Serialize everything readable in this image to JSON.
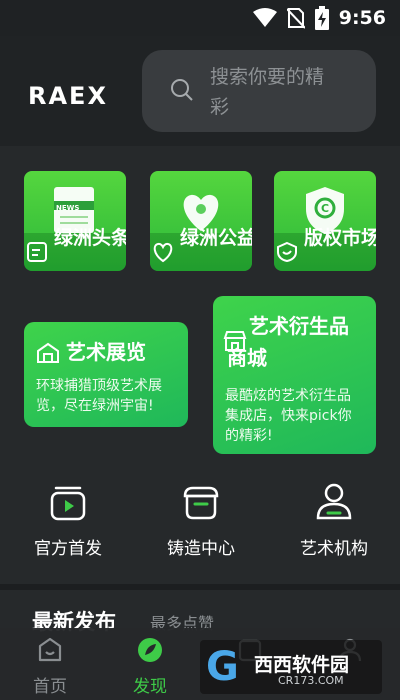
{
  "status_bar": {
    "time": "9:56",
    "icons": [
      "wifi-icon",
      "no-sim-icon",
      "battery-charging-icon"
    ]
  },
  "header": {
    "logo": "RAEX",
    "search": {
      "placeholder_line1": "搜索你要的精",
      "placeholder_line2": "彩",
      "icon": "search-icon"
    }
  },
  "tiles": [
    {
      "label": "绿洲头条",
      "badge": "NEWS",
      "art_icon": "newspaper-icon",
      "icon": "notes-icon"
    },
    {
      "label": "绿洲公益",
      "art_icon": "heart-hands-icon",
      "icon": "heart-outline-icon"
    },
    {
      "label": "版权市场",
      "art_icon": "copyright-shield-icon",
      "icon": "shield-check-icon"
    }
  ],
  "cards": {
    "exhibition": {
      "title": "艺术展览",
      "desc_line1": "环球捕猎顶级艺术展",
      "desc_line2": "览，尽在绿洲宇宙!",
      "icon": "museum-icon"
    },
    "derivative": {
      "title_line1": "艺术衍生品",
      "title_line2": "商城",
      "desc_line1": "最酷炫的艺术衍生品",
      "desc_line2": "集成店，快来pick你",
      "desc_line3": "的精彩!",
      "icon": "shop-icon"
    }
  },
  "functions": [
    {
      "label": "官方首发",
      "icon": "video-stack-icon"
    },
    {
      "label": "铸造中心",
      "icon": "mint-pot-icon"
    },
    {
      "label": "艺术机构",
      "icon": "person-badge-icon"
    }
  ],
  "section": {
    "title": "最新发布",
    "more": "最多点赞"
  },
  "nav": [
    {
      "label": "首页",
      "icon": "home-icon",
      "active": false
    },
    {
      "label": "发现",
      "icon": "discover-icon",
      "active": true
    },
    {
      "label": "",
      "icon": "calendar-icon",
      "active": false
    },
    {
      "label": "",
      "icon": "profile-icon",
      "active": false
    }
  ],
  "watermark": {
    "letter": "G",
    "text": "西西软件园",
    "url": "CR173.COM"
  },
  "colors": {
    "accent": "#3ecb48",
    "background": "#26292b",
    "card_green": "#2cc24a"
  }
}
